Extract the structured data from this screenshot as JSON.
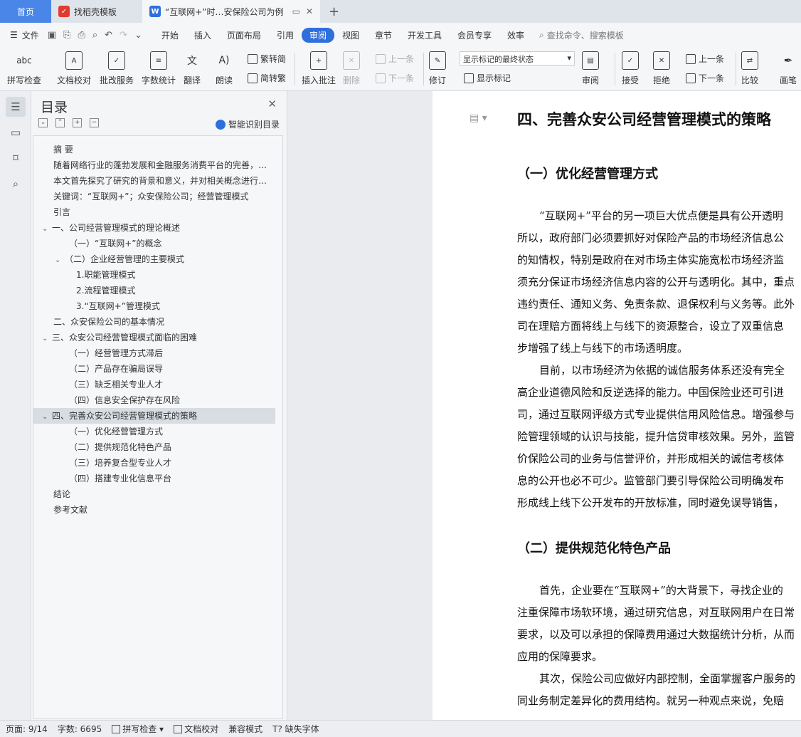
{
  "tabs": {
    "home": "首页",
    "template": "找稻壳模板",
    "document": "“互联网+”时…安保险公司为例"
  },
  "menu": {
    "file": "文件",
    "items": [
      "开始",
      "插入",
      "页面布局",
      "引用",
      "审阅",
      "视图",
      "章节",
      "开发工具",
      "会员专享",
      "效率"
    ],
    "active": "审阅",
    "search": "查找命令、搜索模板"
  },
  "ribbon": {
    "spellcheck": "拼写检查",
    "proofread": "文档校对",
    "review_service": "批改服务",
    "word_count": "字数统计",
    "translate": "翻译",
    "read_aloud": "朗读",
    "simp_to_trad": "繁转简",
    "trad_to_simp": "简转繁",
    "insert_comment": "插入批注",
    "delete": "删除",
    "prev": "上一条",
    "next": "下一条",
    "revision": "修订",
    "display_mode": "显示标记的最终状态",
    "show_markup": "显示标记",
    "review": "审阅",
    "accept": "接受",
    "reject": "拒绝",
    "prev2": "上一条",
    "next2": "下一条",
    "compare": "比较",
    "ink": "画笔"
  },
  "toc": {
    "title": "目录",
    "smart": "智能识别目录",
    "items": [
      "摘  要",
      "随着网络行业的蓬勃发展和金融服务消费平台的完善，…",
      "本文首先探究了研究的背景和意义，并对相关概念进行…",
      "关键词：“互联网+”；众安保险公司；经营管理模式",
      "引言",
      "一、公司经营管理模式的理论概述",
      "（一）“互联网+”的概念",
      "（二）企业经营管理的主要模式",
      "1.职能管理模式",
      "2.流程管理模式",
      "3.“互联网+”管理模式",
      "二、众安保险公司的基本情况",
      "三、众安公司经营管理模式面临的困难",
      "（一）经营管理方式滞后",
      "（二）产品存在骗局误导",
      "（三）缺乏相关专业人才",
      "（四）信息安全保护存在风险",
      "四、完善众安公司经营管理模式的策略",
      "（一）优化经营管理方式",
      "（二）提供规范化特色产品",
      "（三）培养复合型专业人才",
      "（四）搭建专业化信息平台",
      "结论",
      "参考文献"
    ]
  },
  "document": {
    "heading": "四、完善众安公司经营管理模式的策略",
    "sub1": "（一）优化经营管理方式",
    "para1": [
      "“互联网+”平台的另一项巨大优点便是具有公开透明",
      "所以，政府部门必须要抓好对保险产品的市场经济信息公",
      "的知情权，特别是政府在对市场主体实施宽松市场经济监",
      "须充分保证市场经济信息内容的公开与透明化。其中，重点",
      "违约责任、通知义务、免责条款、退保权利与义务等。此外",
      "司在理赔方面将线上与线下的资源整合，设立了双重信息",
      "步增强了线上与线下的市场透明度。"
    ],
    "para2": [
      "目前，以市场经济为依据的诚信服务体系还没有完全",
      "高企业道德风险和反逆选择的能力。中国保险业还可引进",
      "司，通过互联网评级方式专业提供信用风险信息。增强参与",
      "险管理领域的认识与技能，提升信贷审核效果。另外，监管",
      "价保险公司的业务与信誉评价，并形成相关的诚信考核体",
      "息的公开也必不可少。监管部门要引导保险公司明确发布",
      "形成线上线下公开发布的开放标准，同时避免误导销售，"
    ],
    "sub2": "（二）提供规范化特色产品",
    "para3": [
      "首先，企业要在“互联网+”的大背景下，寻找企业的",
      "注重保障市场软环境，通过研究信息，对互联网用户在日常",
      "要求，以及可以承担的保障费用通过大数据统计分析，从而",
      "应用的保障要求。"
    ],
    "para4": [
      "其次，保险公司应做好内部控制，全面掌握客户服务的",
      "同业务制定差异化的费用结构。就另一种观点来说，免赔"
    ]
  },
  "status": {
    "page": "页面: 9/14",
    "words": "字数: 6695",
    "spellcheck": "拼写检查",
    "proofread": "文档校对",
    "compat": "兼容模式",
    "missing_font": "缺失字体"
  },
  "colors": {
    "accent": "#2f6fdc",
    "home_tab": "#4a86e8",
    "selected_toc": "#d8dce3"
  }
}
